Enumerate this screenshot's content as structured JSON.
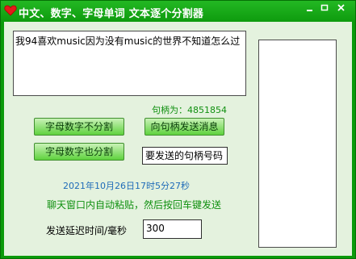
{
  "window": {
    "title": "中文、数字、字母单词 文本逐个分割器"
  },
  "main": {
    "text_area_value": "我94喜欢music因为没有music的世界不知道怎么过",
    "handle_label": "句柄为：4851854",
    "btn_letters_not_split": "字母数字不分割",
    "btn_send_to_handle": "向句柄发送消息",
    "btn_letters_split": "字母数字也分割",
    "handle_input_value": "要发送的句柄号码",
    "timestamp": "2021年10月26日17时5分27秒",
    "hint": "聊天窗口内自动粘贴，然后按回车键发送",
    "delay_label": "发送延迟时间/毫秒",
    "delay_value": "300"
  },
  "icons": {
    "title": "heart-icon",
    "minimize": "minimize-icon",
    "maximize": "maximize-icon",
    "close": "close-icon"
  }
}
